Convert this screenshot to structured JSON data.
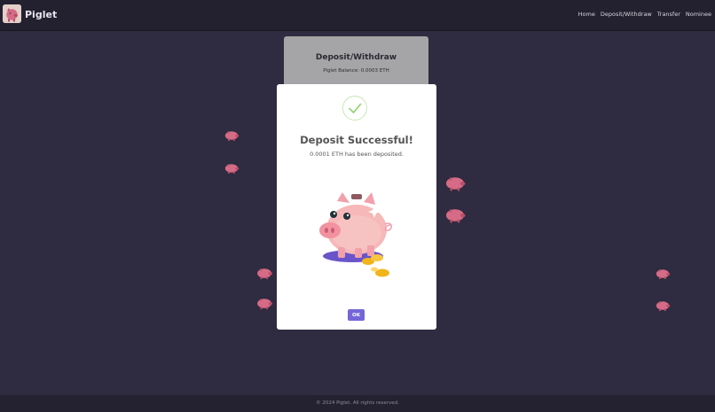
{
  "header": {
    "brand": "Piglet",
    "nav": [
      "Home",
      "Deposit/Withdraw",
      "Transfer",
      "Nominee"
    ]
  },
  "card": {
    "title": "Deposit/Withdraw",
    "balance": "Piglet Balance: 0.0003 ETH"
  },
  "modal": {
    "title": "Deposit Successful!",
    "message": "0.0001 ETH has been deposited.",
    "ok_label": "OK"
  },
  "footer": {
    "text": "© 2024 Piglet. All rights reserved."
  },
  "colors": {
    "background": "#2f2b40",
    "topbar": "#23202f",
    "accent": "#7466d8",
    "pig_pink": "#d56b86",
    "success_green": "#8fd16f"
  }
}
